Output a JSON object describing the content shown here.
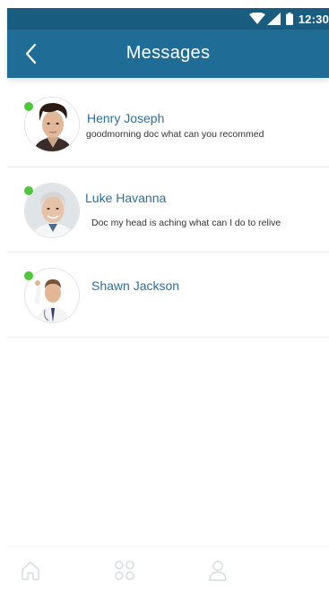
{
  "status_bar": {
    "time": "12:30",
    "icons": [
      "wifi-icon",
      "signal-icon",
      "battery-icon"
    ]
  },
  "header": {
    "title": "Messages",
    "back_icon": "chevron-left-icon",
    "background_color": "#1f6d97"
  },
  "messages": [
    {
      "name": "Henry Joseph",
      "preview": "goodmorning  doc what can you recommed",
      "online": true
    },
    {
      "name": "Luke Havanna",
      "preview": "Doc my head is aching what can I do to relive",
      "online": true
    },
    {
      "name": "Shawn Jackson",
      "preview": "",
      "online": true
    }
  ],
  "bottom_nav": {
    "items": [
      "home-icon",
      "grid-icon",
      "profile-icon"
    ]
  },
  "colors": {
    "accent": "#1f6d97",
    "status_bar": "#185c7f",
    "online": "#4ec83a",
    "name_text": "#2b6fa0"
  }
}
